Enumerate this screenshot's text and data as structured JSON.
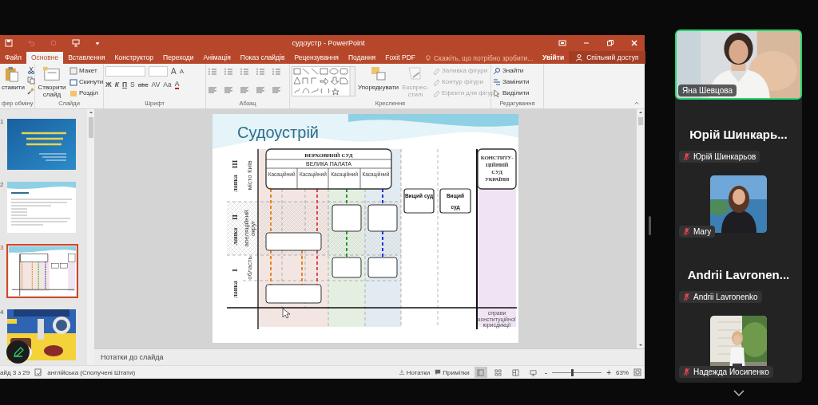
{
  "window": {
    "title": "судоустр - PowerPoint"
  },
  "tabs": [
    {
      "label": "Файл",
      "selected": false
    },
    {
      "label": "Основне",
      "selected": true
    },
    {
      "label": "Вставлення",
      "selected": false
    },
    {
      "label": "Конструктор",
      "selected": false
    },
    {
      "label": "Переходи",
      "selected": false
    },
    {
      "label": "Анімація",
      "selected": false
    },
    {
      "label": "Показ слайдів",
      "selected": false
    },
    {
      "label": "Рецензування",
      "selected": false
    },
    {
      "label": "Подання",
      "selected": false
    },
    {
      "label": "Foxit PDF",
      "selected": false
    }
  ],
  "tell_me": {
    "placeholder": "Скажіть, що потрібно зробити..."
  },
  "account": {
    "sign_in": "Увійти",
    "share": "Спільний доступ"
  },
  "ribbon": {
    "clipboard": {
      "paste": "ставити",
      "label": "фер обміну"
    },
    "slides": {
      "new_slide": "Створити слайд",
      "layout": "Макет",
      "reset": "Скинути",
      "section": "Розділ",
      "label": "Слайди"
    },
    "font": {
      "size_buttons": [
        "A",
        "A"
      ],
      "format_buttons": [
        "Ж",
        "К",
        "П",
        "S",
        "abc",
        "AV",
        "Aa",
        "A"
      ],
      "label": "Шрифт"
    },
    "paragraph": {
      "label": "Абзац"
    },
    "drawing": {
      "arrange": {
        "label": "Упорядкувати",
        "disabled": false
      },
      "quick_styles": {
        "label": "Експрес-стилі",
        "disabled": true
      },
      "shape_commands": [
        {
          "label": "Заливка фігури",
          "disabled": true
        },
        {
          "label": "Контур фігури",
          "disabled": true
        },
        {
          "label": "Ефекти для фігур",
          "disabled": true
        }
      ],
      "label": "Креслення"
    },
    "editing": {
      "commands": [
        {
          "label": "Знайти",
          "disabled": false
        },
        {
          "label": "Замінити",
          "disabled": false
        },
        {
          "label": "Виділити",
          "disabled": false
        }
      ],
      "label": "Редагування"
    }
  },
  "thumbnails": [
    {
      "number": "1",
      "kind": "title",
      "selected": false
    },
    {
      "number": "2",
      "kind": "text",
      "selected": false
    },
    {
      "number": "3",
      "kind": "diagram",
      "selected": true
    },
    {
      "number": "4",
      "kind": "picture",
      "selected": false
    }
  ],
  "slide": {
    "title": "Судоустрій",
    "diagram": {
      "supreme_court": "ВЕРХОВНИЙ СУД",
      "grand_chamber": "ВЕЛИКА ПАЛАТА",
      "cassation_courts": [
        "Касаційний",
        "Касаційний",
        "Касаційний",
        "Касаційний"
      ],
      "levels": [
        {
          "numeral": "III",
          "word": "ланка",
          "area": "місто Київ"
        },
        {
          "numeral": "II",
          "word": "ланка",
          "area": "апеляційний округ"
        },
        {
          "numeral": "I",
          "word": "ланка",
          "area": "область"
        }
      ],
      "high_courts": [
        {
          "heading": "Вищий суд"
        },
        {
          "heading": "Вищий",
          "tail": "суд"
        }
      ],
      "constitutional_court": "КОНСТИТУ-ЦІЙНИЙ СУД УКРАЇНИ",
      "jurisdiction": "справи конституційної юрисдикції"
    }
  },
  "notes": {
    "placeholder": "Нотатки до слайда"
  },
  "status_bar": {
    "slide_counter": "айд 3 з 29",
    "language": "англійська (Сполучені Штати)",
    "notes": "Нотатки",
    "comments": "Примітки",
    "views": [
      {
        "selected": true
      },
      {
        "selected": false
      },
      {
        "selected": false
      },
      {
        "selected": false
      }
    ],
    "zoom_out": "-",
    "zoom_in": "+",
    "zoom": {
      "level": 0.4
    },
    "zoom_level": "63%"
  },
  "participants": [
    {
      "kind": "video",
      "name": "Яна Шевцова",
      "speaking": true,
      "muted": false
    },
    {
      "kind": "name",
      "display": "Юрій Шинкарь...",
      "name": "Юрій Шинкарьов",
      "speaking": false,
      "muted": true
    },
    {
      "name": "Mary",
      "speaking": false,
      "muted": true
    },
    {
      "kind": "name",
      "display": "Andrii Lavronen...",
      "name": "Andrii Lavronenko",
      "speaking": false,
      "muted": true
    },
    {
      "name": "Надежда Иосипенко",
      "speaking": false,
      "muted": true
    }
  ]
}
